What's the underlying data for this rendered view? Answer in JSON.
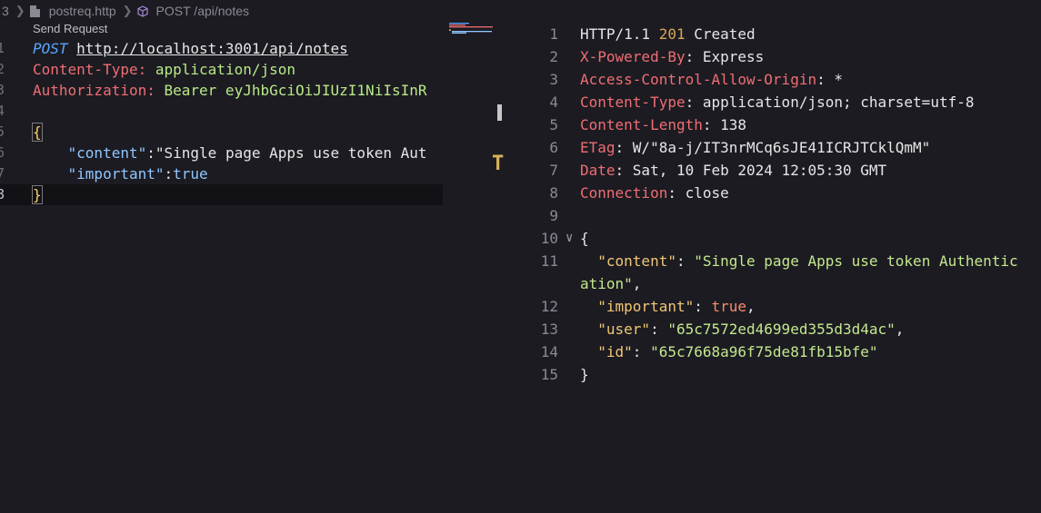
{
  "breadcrumb": {
    "line_prefix": "3",
    "file": "postreq.http",
    "request": "POST /api/notes"
  },
  "codelens": "Send Request",
  "request_editor": {
    "lines": [
      {
        "n": "1"
      },
      {
        "n": "2"
      },
      {
        "n": "3"
      },
      {
        "n": "4"
      },
      {
        "n": "5"
      },
      {
        "n": "6"
      },
      {
        "n": "7"
      },
      {
        "n": "8"
      }
    ],
    "method": "POST",
    "url": "http://localhost:3001/api/notes",
    "header1_name": "Content-Type:",
    "header1_value": "application/json",
    "header2_name": "Authorization:",
    "header2_value": "Bearer eyJhbGciOiJIUzI1NiIsInR",
    "open_brace": "{",
    "key_content": "\"content\"",
    "colon1": ":",
    "val_content": "\"Single page Apps use token Aut",
    "key_important": "\"important\"",
    "colon2": ":",
    "val_important": "true",
    "close_brace": "}"
  },
  "response": {
    "lines": [
      {
        "n": "1"
      },
      {
        "n": "2"
      },
      {
        "n": "3"
      },
      {
        "n": "4"
      },
      {
        "n": "5"
      },
      {
        "n": "6"
      },
      {
        "n": "7"
      },
      {
        "n": "8"
      },
      {
        "n": "9"
      },
      {
        "n": "10"
      },
      {
        "n": "11"
      },
      {
        "n": "12"
      },
      {
        "n": "13"
      },
      {
        "n": "14"
      },
      {
        "n": "15"
      }
    ],
    "status_proto": "HTTP/1.1 ",
    "status_code": "201",
    "status_text": " Created",
    "headers": [
      {
        "name": "X-Powered-By",
        "value": "Express"
      },
      {
        "name": "Access-Control-Allow-Origin",
        "value": "*"
      },
      {
        "name": "Content-Type",
        "value": "application/json; charset=utf-8"
      },
      {
        "name": "Content-Length",
        "value": "138"
      },
      {
        "name": "ETag",
        "value": "W/\"8a-j/IT3nrMCq6sJE41ICRJTCklQmM\""
      },
      {
        "name": "Date",
        "value": "Sat, 10 Feb 2024 12:05:30 GMT"
      },
      {
        "name": "Connection",
        "value": "close"
      }
    ],
    "body": {
      "open": "{",
      "content_key": "\"content\"",
      "content_val": "\"Single page Apps use token Authentication\"",
      "important_key": "\"important\"",
      "important_val": "true",
      "user_key": "\"user\"",
      "user_val": "\"65c7572ed4699ed355d3d4ac\"",
      "id_key": "\"id\"",
      "id_val": "\"65c7668a96f75de81fb15bfe\"",
      "close": "}"
    }
  },
  "colors": {
    "background": "#1c1b22",
    "header_name": "#ee6e73",
    "status_code": "#d9a656",
    "json_key": "#f0c674",
    "json_string": "#c3e88d",
    "json_bool": "#f78c6c"
  },
  "icons": {
    "file": "file-icon",
    "method": "cube-icon",
    "fold": "chevron-down-icon"
  }
}
